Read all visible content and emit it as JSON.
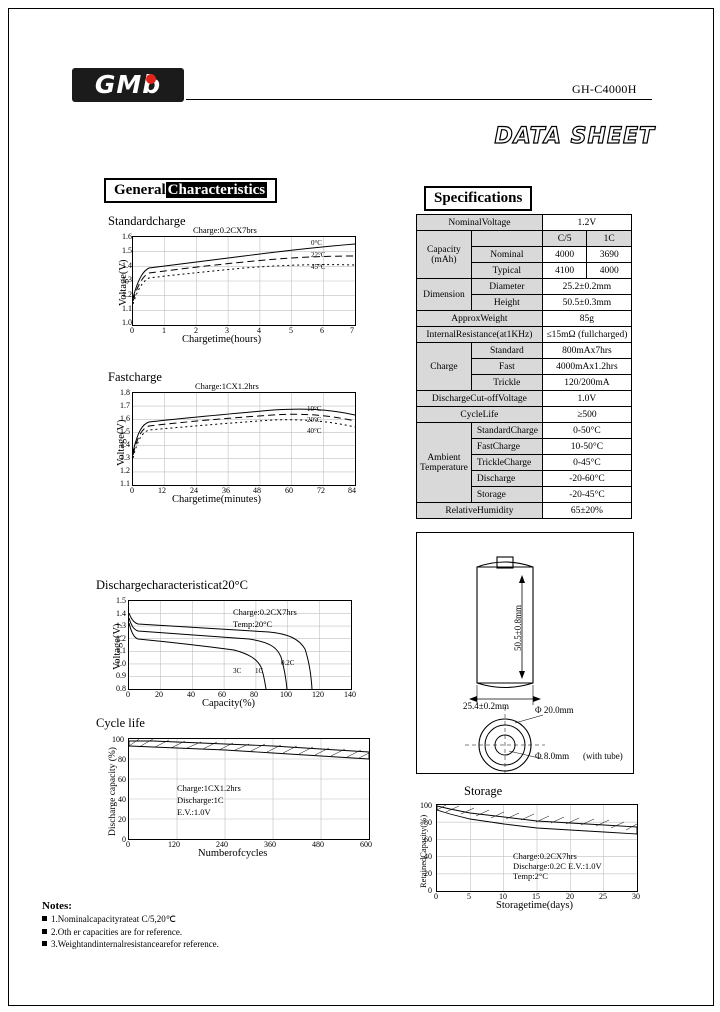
{
  "header": {
    "logo_text": "GMb",
    "model": "GH-C4000H",
    "datasheet": "DATA SHEET"
  },
  "sections": {
    "general": {
      "word1": "General",
      "word2": "Characteristics"
    },
    "specifications": "Specifications"
  },
  "charts": [
    {
      "id": "standard-charge",
      "title": "Standardcharge",
      "type": "line",
      "note": "Charge:0.2CX7brs",
      "xlabel": "Chargetime(hours)",
      "ylabel": "Voltage(V)",
      "xticks": [
        "0",
        "1",
        "2",
        "3",
        "4",
        "5",
        "6",
        "7"
      ],
      "yticks": [
        "1.6",
        "1.5",
        "1.4",
        "1.3",
        "1.2",
        "1.1",
        "1.0"
      ],
      "xlim": [
        0,
        7
      ],
      "ylim": [
        1.0,
        1.6
      ],
      "series": [
        {
          "name": "0 C",
          "label": "0°C",
          "x": [
            0,
            0.5,
            1,
            2,
            3,
            4,
            5,
            6,
            7
          ],
          "y": [
            1.18,
            1.31,
            1.34,
            1.37,
            1.4,
            1.43,
            1.46,
            1.48,
            1.5
          ]
        },
        {
          "name": "22 C",
          "label": "22°C",
          "x": [
            0,
            0.5,
            1,
            2,
            3,
            4,
            5,
            6,
            7
          ],
          "y": [
            1.16,
            1.28,
            1.31,
            1.34,
            1.37,
            1.39,
            1.42,
            1.43,
            1.43
          ]
        },
        {
          "name": "45 C",
          "label": "45°C",
          "x": [
            0,
            0.5,
            1,
            2,
            3,
            4,
            5,
            6,
            7
          ],
          "y": [
            1.14,
            1.25,
            1.28,
            1.31,
            1.33,
            1.35,
            1.37,
            1.37,
            1.36
          ]
        }
      ]
    },
    {
      "id": "fast-charge",
      "title": "Fastcharge",
      "type": "line",
      "note": "Charge:1CX1.2hrs",
      "xlabel": "Chargetime(minutes)",
      "ylabel": "Voltage(V)",
      "xticks": [
        "0",
        "12",
        "24",
        "36",
        "48",
        "60",
        "72",
        "84"
      ],
      "yticks": [
        "1.8",
        "1.7",
        "1.6",
        "1.5",
        "1.4",
        "1.3",
        "1.2",
        "1.1"
      ],
      "xlim": [
        0,
        84
      ],
      "ylim": [
        1.1,
        1.8
      ],
      "series": [
        {
          "name": "10 C",
          "label": "10°C",
          "x": [
            0,
            6,
            12,
            24,
            36,
            48,
            60,
            72,
            84
          ],
          "y": [
            1.35,
            1.5,
            1.53,
            1.56,
            1.59,
            1.62,
            1.64,
            1.62,
            1.58
          ]
        },
        {
          "name": "20 C",
          "label": "20°C",
          "x": [
            0,
            6,
            12,
            24,
            36,
            48,
            60,
            72,
            84
          ],
          "y": [
            1.33,
            1.47,
            1.5,
            1.53,
            1.56,
            1.58,
            1.6,
            1.58,
            1.54
          ]
        },
        {
          "name": "40 C",
          "label": "40°C",
          "x": [
            0,
            6,
            12,
            24,
            36,
            48,
            60,
            72,
            84
          ],
          "y": [
            1.31,
            1.44,
            1.47,
            1.49,
            1.52,
            1.54,
            1.55,
            1.53,
            1.49
          ]
        }
      ]
    },
    {
      "id": "discharge-characteristic",
      "title": "Dischargecharacteristicat20°C",
      "type": "line",
      "note1": "Charge:0.2CX7hrs",
      "note2": "Temp:20°C",
      "xlabel": "Capacity(%)",
      "ylabel": "Voltage(V)",
      "xticks": [
        "0",
        "20",
        "40",
        "60",
        "80",
        "100",
        "120",
        "140"
      ],
      "yticks": [
        "1.5",
        "1.4",
        "1.3",
        "1.2",
        "1.1",
        "1.0",
        "0.9",
        "0.8"
      ],
      "xlim": [
        0,
        140
      ],
      "ylim": [
        0.8,
        1.5
      ],
      "series": [
        {
          "name": "0.2C",
          "label": "0.2C",
          "x": [
            0,
            5,
            20,
            50,
            80,
            100,
            110,
            118,
            122
          ],
          "y": [
            1.4,
            1.34,
            1.32,
            1.3,
            1.28,
            1.25,
            1.2,
            1.05,
            0.85
          ]
        },
        {
          "name": "1C",
          "label": "1C",
          "x": [
            0,
            5,
            20,
            50,
            80,
            95,
            102,
            106
          ],
          "y": [
            1.36,
            1.28,
            1.26,
            1.24,
            1.21,
            1.15,
            1.0,
            0.85
          ]
        },
        {
          "name": "3C",
          "label": "3C",
          "x": [
            0,
            5,
            20,
            50,
            70,
            80,
            86,
            90
          ],
          "y": [
            1.32,
            1.22,
            1.2,
            1.17,
            1.13,
            1.05,
            0.93,
            0.85
          ]
        }
      ]
    },
    {
      "id": "cycle-life",
      "title": "Cycle life",
      "type": "line",
      "note1": "Charge:1CX1.2hrs",
      "note2": "Discharge:1C",
      "note3": "E.V.:1.0V",
      "xlabel": "Numberofcycles",
      "ylabel": "Discharge capacity (%)",
      "xticks": [
        "0",
        "120",
        "240",
        "360",
        "480",
        "600"
      ],
      "yticks": [
        "100",
        "80",
        "60",
        "40",
        "20",
        "0"
      ],
      "xlim": [
        0,
        600
      ],
      "ylim": [
        0,
        100
      ],
      "series": [
        {
          "name": "upper",
          "x": [
            0,
            60,
            120,
            240,
            360,
            480,
            600
          ],
          "y": [
            100,
            100,
            99,
            98,
            97,
            95,
            93
          ]
        },
        {
          "name": "lower",
          "x": [
            0,
            60,
            120,
            240,
            360,
            480,
            600
          ],
          "y": [
            96,
            95,
            94,
            92,
            90,
            88,
            85
          ]
        }
      ]
    },
    {
      "id": "storage",
      "title": "Storage",
      "type": "line",
      "note1": "Charge:0.2CX7hrs",
      "note2": "Discharge:0.2C  E.V.:1.0V",
      "note3": "Temp:2°C",
      "xlabel": "Storagetime(days)",
      "ylabel": "RetainedCapacity(%)",
      "xticks": [
        "0",
        "5",
        "10",
        "15",
        "20",
        "25",
        "30"
      ],
      "yticks": [
        "100",
        "80",
        "60",
        "40",
        "20",
        "0"
      ],
      "xlim": [
        0,
        30
      ],
      "ylim": [
        0,
        100
      ],
      "series": [
        {
          "name": "upper",
          "x": [
            0,
            2,
            5,
            10,
            15,
            20,
            25,
            30
          ],
          "y": [
            100,
            96,
            92,
            87,
            83,
            80,
            77,
            75
          ]
        },
        {
          "name": "lower",
          "x": [
            0,
            2,
            5,
            10,
            15,
            20,
            25,
            30
          ],
          "y": [
            95,
            90,
            86,
            80,
            76,
            72,
            69,
            67
          ]
        }
      ]
    }
  ],
  "spec_table": {
    "rows": [
      {
        "label": "NominalVoltage",
        "value": "1.2V"
      },
      {
        "label": "Capacity(mAh)",
        "sub": [
          {
            "name": "",
            "c5": "C/5",
            "c1": "1C"
          },
          {
            "name": "Nominal",
            "c5": "4000",
            "c1": "3690"
          },
          {
            "name": "Typical",
            "c5": "4100",
            "c1": "4000"
          }
        ]
      },
      {
        "label": "Dimension",
        "sub": [
          {
            "name": "Diameter",
            "value": "25.2±0.2mm"
          },
          {
            "name": "Height",
            "value": "50.5±0.3mm"
          }
        ]
      },
      {
        "label": "ApproxWeight",
        "value": "85g"
      },
      {
        "label": "InternalResistance(at1KHz)",
        "value": "≤15mΩ (fullcharged)"
      },
      {
        "label": "Charge",
        "sub": [
          {
            "name": "Standard",
            "value": "800mAx7hrs"
          },
          {
            "name": "Fast",
            "value": "4000mAx1.2hrs"
          },
          {
            "name": "Trickle",
            "value": "120/200mA"
          }
        ]
      },
      {
        "label": "DischargeCut-offVoltage",
        "value": "1.0V"
      },
      {
        "label": "CycleLife",
        "value": "≥500"
      },
      {
        "label": "AmbientTemperature",
        "sub": [
          {
            "name": "StandardCharge",
            "value": "0-50°C"
          },
          {
            "name": "FastCharge",
            "value": "10-50°C"
          },
          {
            "name": "TrickleCharge",
            "value": "0-45°C"
          },
          {
            "name": "Discharge",
            "value": "-20-60°C"
          },
          {
            "name": "Storage",
            "value": "-20-45°C"
          }
        ]
      },
      {
        "label": "RelativeHumidity",
        "value": "65±20%"
      }
    ]
  },
  "drawing": {
    "height_label": "50.5±0.8mm",
    "diameter_label": "25.4±0.2mm",
    "outer_dia": "Φ 20.0mm",
    "inner_dia": "Φ 8.0mm",
    "with_tube": "(with tube)"
  },
  "notes": {
    "title": "Notes:",
    "items": [
      "1.Nominalcapacityrateat C/5,20℃",
      "2.Oth er capacities are for reference.",
      "3.Weightandinternalresistancearefor reference."
    ]
  }
}
